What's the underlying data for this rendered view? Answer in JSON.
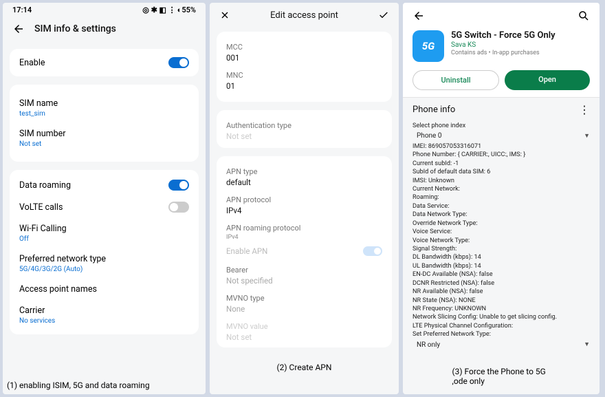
{
  "panel1": {
    "time": "17:14",
    "status_icons": "◎ ✱ ◧ ⋮",
    "battery": "◐55%",
    "title": "SIM info & settings",
    "enable_label": "Enable",
    "sim_name_label": "SIM name",
    "sim_name_value": "test_sim",
    "sim_number_label": "SIM number",
    "sim_number_value": "Not set",
    "data_roaming": "Data roaming",
    "volte": "VoLTE calls",
    "wifi_calling": "Wi-Fi Calling",
    "wifi_calling_value": "Off",
    "pref_net": "Preferred network type",
    "pref_net_value": "5G/4G/3G/2G (Auto)",
    "apn": "Access point names",
    "carrier": "Carrier",
    "carrier_value": "No services",
    "caption": "(1) enabling ISIM, 5G and data roaming"
  },
  "panel2": {
    "title": "Edit access point",
    "mcc_label": "MCC",
    "mcc_value": "001",
    "mnc_label": "MNC",
    "mnc_value": "01",
    "auth_label": "Authentication type",
    "auth_value": "Not set",
    "apntype_label": "APN type",
    "apntype_value": "default",
    "apnproto_label": "APN protocol",
    "apnproto_value": "IPv4",
    "apnroam_label": "APN roaming protocol",
    "apnroam_value": "IPv4",
    "enable_apn": "Enable APN",
    "bearer_label": "Bearer",
    "bearer_value": "Not specified",
    "mvno_type_label": "MVNO type",
    "mvno_type_value": "None",
    "mvno_value_label": "MVNO value",
    "mvno_value_value": "Not set",
    "caption": "(2) Create APN"
  },
  "panel3": {
    "app_title": "5G Switch - Force 5G Only",
    "dev": "Sava KS",
    "sub": "Contains ads • In-app purchases",
    "uninstall": "Uninstall",
    "open": "Open",
    "info_header": "Phone info",
    "select_label": "Select phone index",
    "phone_sel": "Phone 0",
    "lines": [
      "IMEI: 869057053316071",
      "Phone Number:  { CARRIER:, UICC:, IMS: }",
      "Current subId: -1",
      "SubId of default data SIM: 6",
      "IMSI: Unknown",
      "Current Network:",
      "Roaming:",
      "Data Service:",
      "Data Network Type:",
      "Override Network Type:",
      "Voice Service:",
      "Voice Network Type:",
      "Signal Strength:",
      "DL Bandwidth (kbps): 14",
      "UL Bandwidth (kbps): 14",
      "EN-DC Available (NSA): false",
      "DCNR Restricted (NSA): false",
      "NR Available (NSA): false",
      "NR State (NSA): NONE",
      "NR Frequency: UNKNOWN",
      "Network Slicing Config: Unable to get slicing config.",
      "LTE Physical Channel Configuration:",
      "Set Preferred Network Type:"
    ],
    "nr_only": "NR only",
    "caption": "(3) Force the Phone to 5G ,ode only"
  }
}
